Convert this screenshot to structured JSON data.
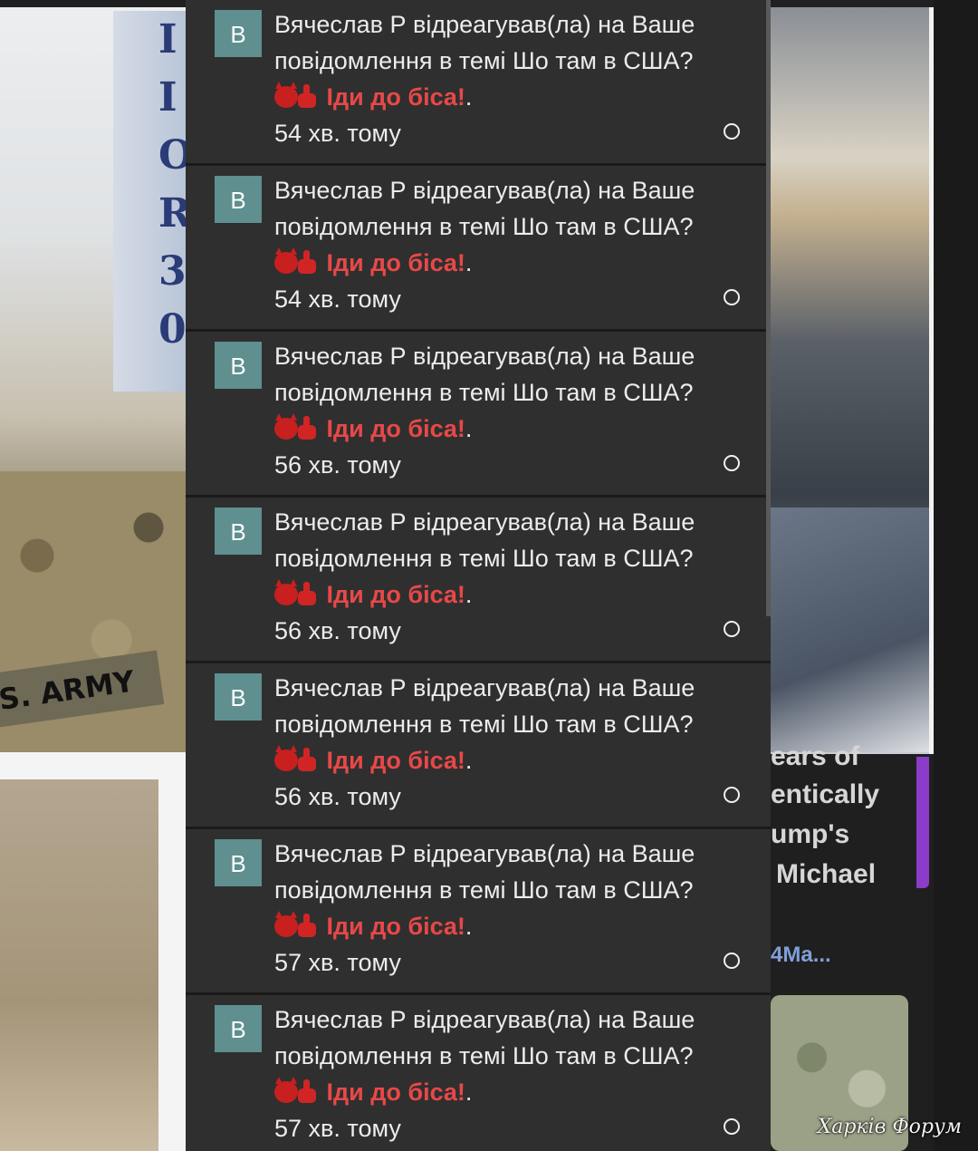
{
  "background": {
    "left_flag_letters": [
      "I",
      "I",
      "O",
      "R",
      "3",
      "0"
    ],
    "left_patch_text": "S. ARMY",
    "right_text_lines": [
      "ears of",
      "entically",
      "ump's",
      "Michael",
      "4Ma..."
    ],
    "watermark": "Харків Форум"
  },
  "colors": {
    "popup_bg": "#2f2f2f",
    "avatar_bg": "#5f8f8f",
    "reaction_red": "#e84848",
    "text": "#ececec"
  },
  "notifications": [
    {
      "avatar_letter": "В",
      "line1": "Вячеслав Р відреагував(ла) на Ваше",
      "line2": "повідомлення в темі Шо там в США?",
      "reaction_icon": "devil-middle-finger-icon",
      "reaction": "Іди до біса!",
      "reaction_suffix": ".",
      "time": "54 хв. тому"
    },
    {
      "avatar_letter": "В",
      "line1": "Вячеслав Р відреагував(ла) на Ваше",
      "line2": "повідомлення в темі Шо там в США?",
      "reaction_icon": "devil-middle-finger-icon",
      "reaction": "Іди до біса!",
      "reaction_suffix": ".",
      "time": "54 хв. тому"
    },
    {
      "avatar_letter": "В",
      "line1": "Вячеслав Р відреагував(ла) на Ваше",
      "line2": "повідомлення в темі Шо там в США?",
      "reaction_icon": "devil-middle-finger-icon",
      "reaction": "Іди до біса!",
      "reaction_suffix": ".",
      "time": "56 хв. тому"
    },
    {
      "avatar_letter": "В",
      "line1": "Вячеслав Р відреагував(ла) на Ваше",
      "line2": "повідомлення в темі Шо там в США?",
      "reaction_icon": "devil-middle-finger-icon",
      "reaction": "Іди до біса!",
      "reaction_suffix": ".",
      "time": "56 хв. тому"
    },
    {
      "avatar_letter": "В",
      "line1": "Вячеслав Р відреагував(ла) на Ваше",
      "line2": "повідомлення в темі Шо там в США?",
      "reaction_icon": "devil-middle-finger-icon",
      "reaction": "Іди до біса!",
      "reaction_suffix": ".",
      "time": "56 хв. тому"
    },
    {
      "avatar_letter": "В",
      "line1": "Вячеслав Р відреагував(ла) на Ваше",
      "line2": "повідомлення в темі Шо там в США?",
      "reaction_icon": "devil-middle-finger-icon",
      "reaction": "Іди до біса!",
      "reaction_suffix": ".",
      "time": "57 хв. тому"
    },
    {
      "avatar_letter": "В",
      "line1": "Вячеслав Р відреагував(ла) на Ваше",
      "line2": "повідомлення в темі Шо там в США?",
      "reaction_icon": "devil-middle-finger-icon",
      "reaction": "Іди до біса!",
      "reaction_suffix": ".",
      "time": "57 хв. тому"
    }
  ]
}
